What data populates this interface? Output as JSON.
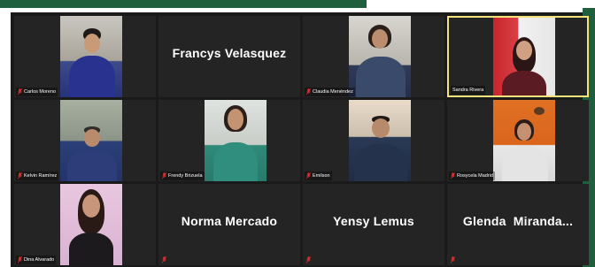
{
  "participants": [
    {
      "name": "Carlos Moreno",
      "has_video": true,
      "muted": true
    },
    {
      "name": "Francys Velasquez",
      "has_video": false,
      "muted": false
    },
    {
      "name": "Claudia Menéndez",
      "has_video": true,
      "muted": true
    },
    {
      "name": "Sandra Rivera",
      "has_video": true,
      "muted": false,
      "active_speaker": true
    },
    {
      "name": "Kelvin Ramírez",
      "has_video": true,
      "muted": true
    },
    {
      "name": "Frendy Brizuela",
      "has_video": true,
      "muted": true
    },
    {
      "name": "Emilson",
      "has_video": true,
      "muted": true
    },
    {
      "name": "Rosycela Madrid",
      "has_video": true,
      "muted": true
    },
    {
      "name": "Dina Alvarado",
      "has_video": true,
      "muted": true
    },
    {
      "name": "Norma Mercado",
      "has_video": false,
      "muted": true
    },
    {
      "name": "Yensy Lemus",
      "has_video": false,
      "muted": true
    },
    {
      "name": "Glenda  Miranda...",
      "has_video": false,
      "muted": true
    }
  ],
  "colors": {
    "accent_green": "#1f5f3d",
    "active_border": "#f4e27a",
    "muted_mic": "#e0312f",
    "tile_bg": "#242424"
  },
  "icons": {
    "muted": "mic-muted-icon"
  }
}
